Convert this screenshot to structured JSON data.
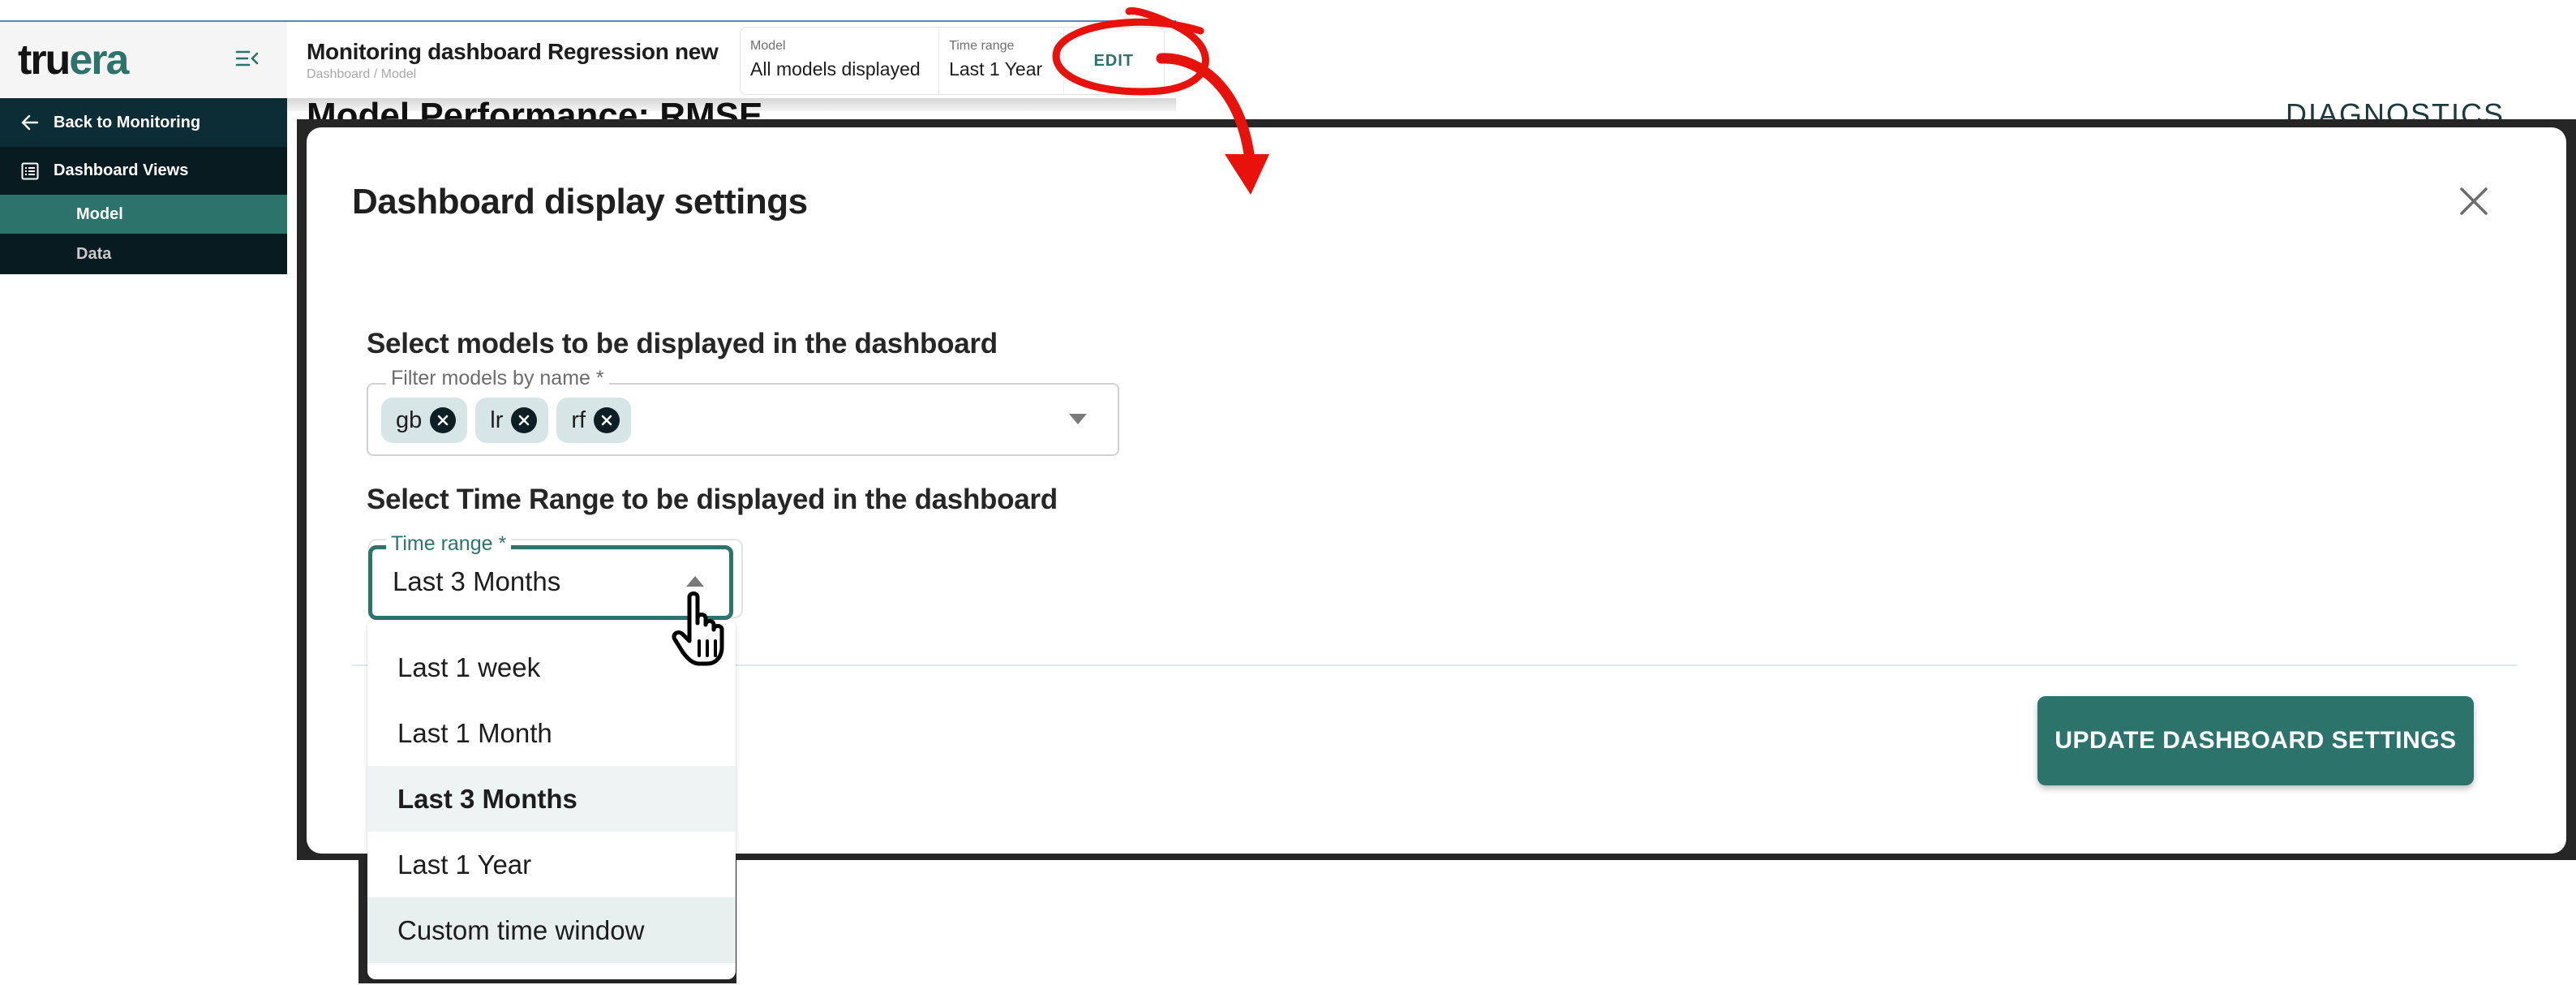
{
  "brand": {
    "logo_part1": "tru",
    "logo_part2": "era",
    "accent_color": "#2c736c"
  },
  "sidebar": {
    "back_label": "Back to Monitoring",
    "section_label": "Dashboard Views",
    "items": [
      {
        "label": "Model",
        "active": true
      },
      {
        "label": "Data",
        "active": false
      }
    ]
  },
  "header": {
    "title": "Monitoring dashboard Regression new",
    "breadcrumb": "Dashboard / Model",
    "model_label": "Model",
    "model_value": "All models displayed",
    "time_label": "Time range",
    "time_value": "Last 1 Year",
    "edit_label": "EDIT"
  },
  "background": {
    "card_title": "Model Performance: RMSE",
    "right_label": "DIAGNOSTICS"
  },
  "modal": {
    "title": "Dashboard display settings",
    "models_heading": "Select models to be displayed in the dashboard",
    "models_field_label": "Filter models by name *",
    "selected_models": [
      "gb",
      "lr",
      "rf"
    ],
    "time_heading": "Select Time Range to be displayed in the dashboard",
    "time_field_label": "Time range *",
    "time_value": "Last 3 Months",
    "submit_label": "UPDATE DASHBOARD SETTINGS"
  },
  "dropdown": {
    "options": [
      "Last 1 week",
      "Last 1 Month",
      "Last 3 Months",
      "Last 1 Year",
      "Custom time window"
    ],
    "selected": "Last 3 Months",
    "hovered": "Custom time window"
  }
}
